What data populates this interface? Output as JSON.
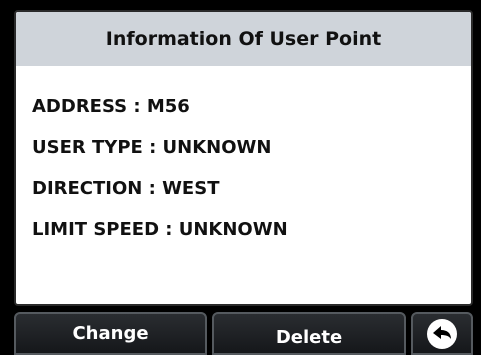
{
  "panel": {
    "title": "Information Of User Point",
    "rows": [
      {
        "text": "ADDRESS : M56"
      },
      {
        "text": "USER TYPE : UNKNOWN"
      },
      {
        "text": "DIRECTION : WEST"
      },
      {
        "text": "LIMIT SPEED : UNKNOWN"
      }
    ]
  },
  "buttons": {
    "change": "Change",
    "delete": "Delete",
    "back_icon": "back-arrow-icon"
  },
  "colors": {
    "header_bg": "#cfd4da",
    "panel_bg": "#ffffff",
    "screen_bg": "#000000",
    "button_bg": "#1e2124"
  }
}
